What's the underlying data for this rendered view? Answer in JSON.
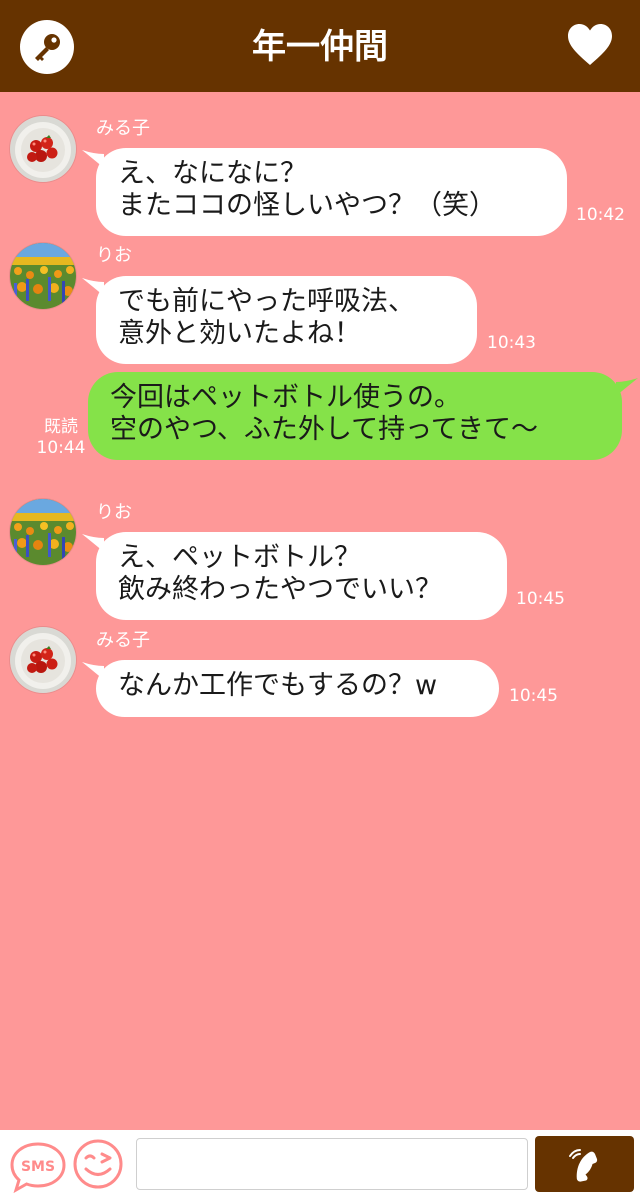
{
  "header": {
    "title": "年一仲間",
    "left_icon": "key-icon",
    "right_icon": "heart-icon"
  },
  "messages": [
    {
      "side": "left",
      "sender": "みる子",
      "avatar": "tomato-avatar",
      "lines": [
        "え、なになに？",
        "またココの怪しいやつ？（笑）"
      ],
      "time": "10:42"
    },
    {
      "side": "left",
      "sender": "りお",
      "avatar": "flower-field-avatar",
      "lines": [
        "でも前にやった呼吸法、",
        "意外と効いたよね！"
      ],
      "time": "10:43"
    },
    {
      "side": "right",
      "lines": [
        "今回はペットボトル使うの。",
        "空のやつ、ふた外して持ってきて〜"
      ],
      "read": "既読",
      "time": "10:44"
    },
    {
      "side": "left",
      "sender": "りお",
      "avatar": "flower-field-avatar",
      "lines": [
        "え、ペットボトル？",
        "飲み終わったやつでいい？"
      ],
      "time": "10:45"
    },
    {
      "side": "left",
      "sender": "みる子",
      "avatar": "tomato-avatar",
      "lines": [
        "なんか工作でもするの？w"
      ],
      "time": "10:45"
    }
  ],
  "bottom_bar": {
    "sms_label": "SMS",
    "input_value": "",
    "input_placeholder": "",
    "call_icon": "phone-icon",
    "emoji_icon": "wink-face-icon"
  },
  "colors": {
    "header_bg": "#663300",
    "chat_bg": "#fe9898",
    "left_bubble": "#ffffff",
    "right_bubble": "#85e249"
  }
}
